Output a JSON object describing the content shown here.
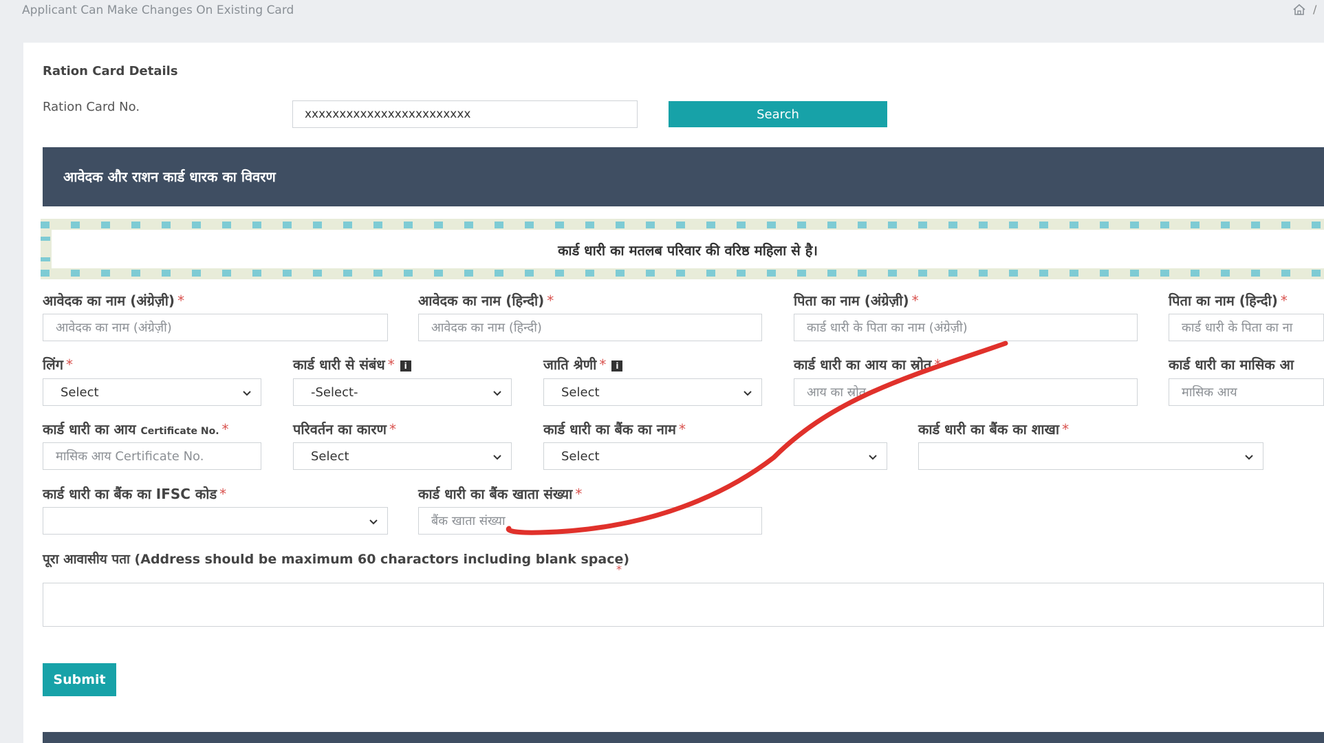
{
  "top_bar": {
    "title": "Applicant Can Make Changes On Existing Card",
    "edge_mark": "/"
  },
  "ration_card": {
    "section_title": "Ration Card Details",
    "number_label": "Ration Card No.",
    "number_value": "xxxxxxxxxxxxxxxxxxxxxxxx",
    "search_label": "Search"
  },
  "applicant_header": "आवेदक और राशन कार्ड धारक का विवरण",
  "notice": "कार्ड धारी का मतलब परिवार की वरिष्ठ महिला से है।",
  "fields": {
    "name_en": {
      "label": "आवेदक का नाम (अंग्रेज़ी)",
      "placeholder": "आवेदक का नाम (अंग्रेज़ी)"
    },
    "name_hi": {
      "label": "आवेदक का नाम (हिन्दी)",
      "placeholder": "आवेदक का नाम (हिन्दी)"
    },
    "father_en": {
      "label": "पिता का नाम (अंग्रेज़ी)",
      "placeholder": "कार्ड धारी के पिता का नाम (अंग्रेज़ी)"
    },
    "father_hi": {
      "label": "पिता का नाम (हिन्दी)",
      "placeholder": "कार्ड धारी के पिता का ना"
    },
    "gender": {
      "label": "लिंग",
      "value": "Select"
    },
    "relation": {
      "label": "कार्ड धारी से संबंध",
      "value": "-Select-"
    },
    "caste": {
      "label": "जाति श्रेणी",
      "value": "Select"
    },
    "income_source": {
      "label": "कार्ड धारी का आय का स्रोत",
      "placeholder": "आय का स्रोत"
    },
    "monthly_income": {
      "label": "कार्ड धारी का मासिक आ",
      "placeholder": "मासिक आय"
    },
    "income_cert_prefix": "कार्ड धारी का आय",
    "income_cert_suffix": "Certificate No.",
    "income_cert_placeholder": "मासिक आय Certificate No.",
    "change_reason": {
      "label": "परिवर्तन का कारण",
      "value": "Select"
    },
    "bank_name": {
      "label": "कार्ड धारी का बैंक का नाम",
      "value": "Select"
    },
    "bank_branch": {
      "label": "कार्ड धारी का बैंक का शाखा",
      "value": ""
    },
    "ifsc": {
      "label": "कार्ड धारी का बैंक का IFSC कोड",
      "value": ""
    },
    "account_no": {
      "label": "कार्ड धारी का बैंक खाता संख्या",
      "placeholder": "बैंक खाता संख्या"
    }
  },
  "required_mark": "*",
  "info_icon_glyph": "i",
  "address": {
    "label": "पूरा आवासीय पता (Address should be maximum 60 charactors including blank space)",
    "value": ""
  },
  "submit_label": "Submit",
  "colors": {
    "accent": "#17a2a8",
    "header_bg": "#3f4e62",
    "required": "#d9534f",
    "annotation_stroke": "#e0312b"
  }
}
